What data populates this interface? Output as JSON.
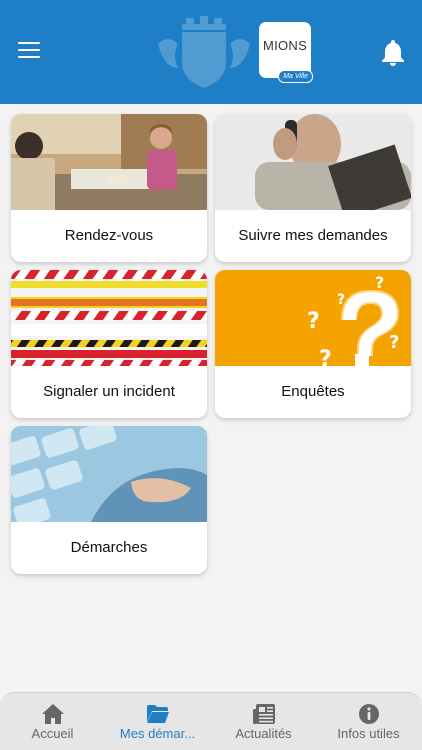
{
  "header": {
    "logo_title": "MIONS",
    "logo_tagline": "Ma Ville"
  },
  "cards": [
    {
      "label": "Rendez-vous"
    },
    {
      "label": "Suivre mes demandes"
    },
    {
      "label": "Signaler un incident"
    },
    {
      "label": "Enquêtes"
    },
    {
      "label": "Démarches"
    }
  ],
  "tabs": [
    {
      "label": "Accueil"
    },
    {
      "label": "Mes démar..."
    },
    {
      "label": "Actualités"
    },
    {
      "label": "Infos utiles"
    }
  ],
  "colors": {
    "brand": "#1e7fc6",
    "tab_inactive": "#666666",
    "background": "#f3f3f3"
  }
}
